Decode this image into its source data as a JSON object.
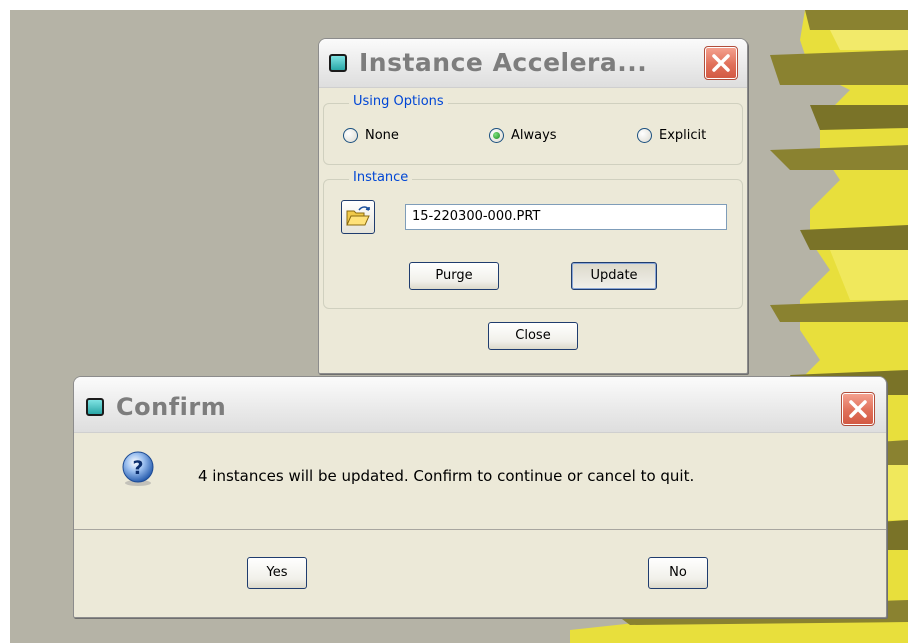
{
  "instance_dialog": {
    "title": "Instance Accelera...",
    "using_options": {
      "legend": "Using Options",
      "options": [
        {
          "label": "None",
          "checked": false
        },
        {
          "label": "Always",
          "checked": true
        },
        {
          "label": "Explicit",
          "checked": false
        }
      ]
    },
    "instance_group": {
      "legend": "Instance",
      "value": "15-220300-000.PRT"
    },
    "purge_label": "Purge",
    "update_label": "Update",
    "close_label": "Close"
  },
  "confirm_dialog": {
    "title": "Confirm",
    "message": "4 instances will be updated. Confirm to continue or cancel to quit.",
    "yes_label": "Yes",
    "no_label": "No"
  },
  "colors": {
    "viewport_bg": "#b5b3a6",
    "model_yellow": "#e8df3c",
    "model_shadow": "#8a8230",
    "legend_blue": "#0046d5",
    "close_red": "#e0705a"
  },
  "icons": {
    "title_icon": "app-cube-icon",
    "close_icon": "close-x-icon",
    "folder_icon": "open-folder-icon",
    "question_icon": "question-mark-icon"
  }
}
